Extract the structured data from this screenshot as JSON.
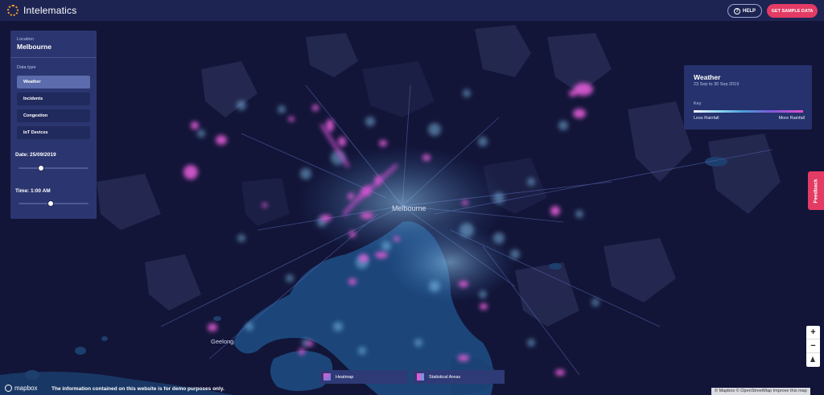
{
  "header": {
    "brand": "Intelematics",
    "help_label": "HELP",
    "cta_label": "GET SAMPLE DATA"
  },
  "panel": {
    "location_caption": "Location",
    "location_value": "Melbourne",
    "data_type_caption": "Data type",
    "data_types": [
      {
        "label": "Weather",
        "active": true
      },
      {
        "label": "Incidents",
        "active": false
      },
      {
        "label": "Congestion",
        "active": false
      },
      {
        "label": "IoT Devices",
        "active": false
      }
    ],
    "date_label": "Date: 25/09/2019",
    "date_slider_value": 0.3,
    "time_label": "Time: 1:00 AM",
    "time_slider_value": 0.45
  },
  "weather": {
    "title": "Weather",
    "range": "23 Sep to 30 Sep 2019",
    "key_label": "Key",
    "low_label": "Less Rainfall",
    "high_label": "More Rainfall"
  },
  "feedback_label": "Feedback",
  "zoom": {
    "in": "+",
    "out": "−"
  },
  "map_labels": {
    "city": "Melbourne",
    "geelong": "Geelong"
  },
  "legend": {
    "heatmap": "Heatmap",
    "statistical": "Statistical Areas"
  },
  "footer": {
    "mapbox": "mapbox",
    "disclaimer": "The information contained on this website is for demo purposes only.",
    "attribution": "© Mapbox © OpenStreetMap  Improve this map"
  },
  "colors": {
    "accent": "#e33b64",
    "panel": "#2b3670",
    "land": "#121538",
    "water": "#1f4f86",
    "heat": "#e05bd6"
  }
}
